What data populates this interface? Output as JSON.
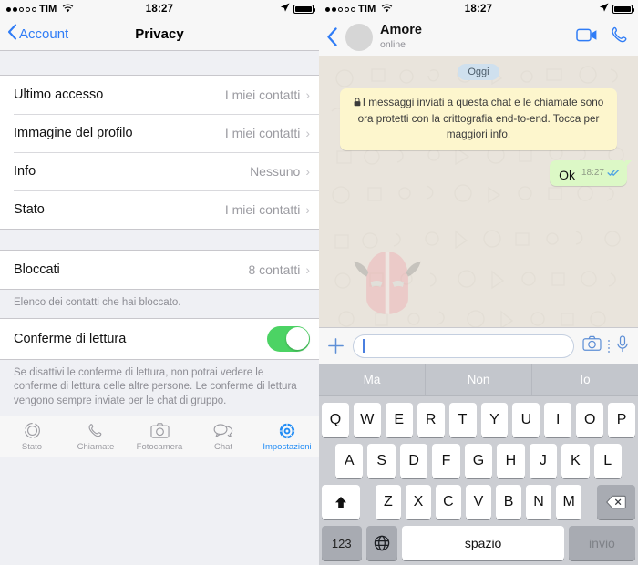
{
  "statusbar": {
    "carrier": "TIM",
    "time": "18:27",
    "signal_dots_filled": 2,
    "signal_dots_total": 5,
    "wifi_icon": "wifi-icon",
    "location_icon": "location-arrow-icon",
    "battery_icon": "battery-icon"
  },
  "left": {
    "nav": {
      "back_label": "Account",
      "back_icon": "chevron-left-icon",
      "title": "Privacy"
    },
    "privacy_rows": [
      {
        "label": "Ultimo accesso",
        "value": "I miei contatti",
        "chevron": "chevron-right-icon"
      },
      {
        "label": "Immagine del profilo",
        "value": "I miei contatti",
        "chevron": "chevron-right-icon"
      },
      {
        "label": "Info",
        "value": "Nessuno",
        "chevron": "chevron-right-icon"
      },
      {
        "label": "Stato",
        "value": "I miei contatti",
        "chevron": "chevron-right-icon"
      }
    ],
    "blocked_row": {
      "label": "Bloccati",
      "value": "8 contatti",
      "chevron": "chevron-right-icon",
      "footnote": "Elenco dei contatti che hai bloccato."
    },
    "read_receipts": {
      "label": "Conferme di lettura",
      "toggle_state": "on",
      "toggle_color": "#4cd364",
      "footnote": "Se disattivi le conferme di lettura, non potrai vedere le conferme di lettura delle altre persone. Le conferme di lettura vengono sempre inviate per le chat di gruppo."
    },
    "tabs": [
      {
        "label": "Stato",
        "icon": "status-circle-icon",
        "active": false
      },
      {
        "label": "Chiamate",
        "icon": "phone-icon",
        "active": false
      },
      {
        "label": "Fotocamera",
        "icon": "camera-icon",
        "active": false
      },
      {
        "label": "Chat",
        "icon": "chat-bubbles-icon",
        "active": false
      },
      {
        "label": "Impostazioni",
        "icon": "gear-icon",
        "active": true
      }
    ],
    "accent_color": "#2f7cf6",
    "active_tab_color": "#1f8bf5"
  },
  "right": {
    "nav": {
      "back_icon": "chevron-left-icon",
      "avatar": "contact-avatar",
      "name": "Amore",
      "status": "online",
      "video_call_icon": "video-camera-icon",
      "voice_call_icon": "phone-icon"
    },
    "chat": {
      "day_pill": "Oggi",
      "encryption_notice": {
        "lock_icon": "lock-icon",
        "text": "I messaggi inviati a questa chat e le chiamate sono ora protetti con la crittografia end-to-end. Tocca per maggiori info.",
        "background": "#fdf6cd"
      },
      "watermark_icon": "viking-helmet-logo",
      "messages": [
        {
          "text": "Ok",
          "time": "18:27",
          "direction": "outgoing",
          "status_icon": "double-check-icon",
          "status_color": "#4fa3e3",
          "bubble_color": "#dcf8c6"
        }
      ]
    },
    "input": {
      "plus_icon": "plus-icon",
      "placeholder": "",
      "value": "",
      "camera_icon": "camera-icon",
      "more_icon": "more-vertical-icon",
      "mic_icon": "microphone-icon"
    },
    "keyboard": {
      "predictions": [
        "Ma",
        "Non",
        "Io"
      ],
      "row1": [
        "Q",
        "W",
        "E",
        "R",
        "T",
        "Y",
        "U",
        "I",
        "O",
        "P"
      ],
      "row2": [
        "A",
        "S",
        "D",
        "F",
        "G",
        "H",
        "J",
        "K",
        "L"
      ],
      "row3": [
        "Z",
        "X",
        "C",
        "V",
        "B",
        "N",
        "M"
      ],
      "shift_icon": "shift-up-arrow-icon",
      "delete_icon": "backspace-delete-icon",
      "numbers_key": "123",
      "globe_icon": "globe-language-icon",
      "space_key": "spazio",
      "send_key": "invio"
    }
  }
}
